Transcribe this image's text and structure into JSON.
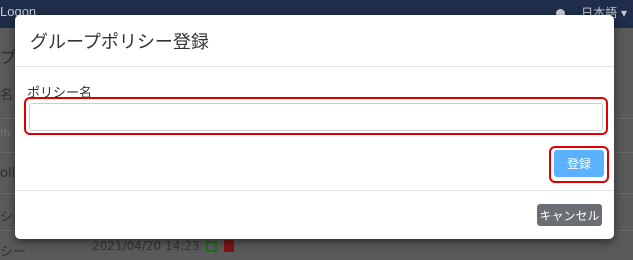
{
  "background": {
    "brand": "Logon",
    "language": "日本語 ▾",
    "left_fragments": [
      "プ",
      "名",
      "th",
      "olicy",
      "シー",
      "シー"
    ],
    "date": "2021/04/20 14:23"
  },
  "modal": {
    "title": "グループポリシー登録",
    "policy_name_label": "ポリシー名",
    "policy_name_value": "",
    "policy_name_placeholder": "",
    "register_label": "登録",
    "cancel_label": "キャンセル"
  },
  "colors": {
    "navbar": "#1f2d4a",
    "primary_button": "#5bb1fb",
    "secondary_button": "#6b6f73",
    "highlight": "#e00000"
  }
}
